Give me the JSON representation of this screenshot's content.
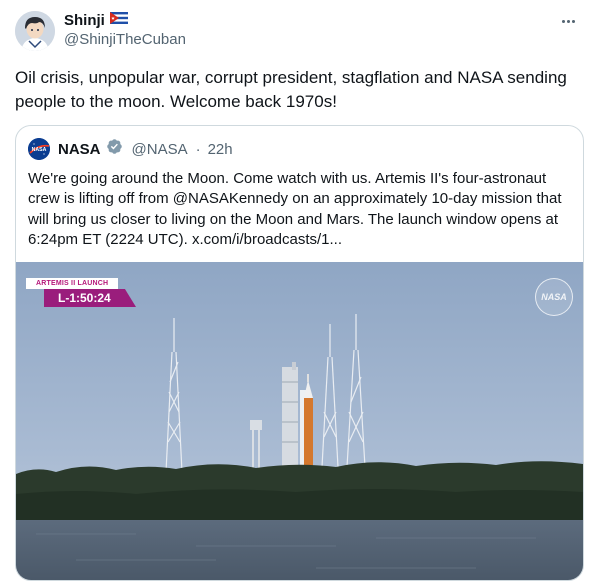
{
  "author": {
    "name": "Shinji",
    "flag_icon": "cuba-flag-icon",
    "handle": "@ShinjiTheCuban",
    "more_icon": "more-options-icon"
  },
  "tweet": {
    "text": "Oil crisis, unpopular war, corrupt president, stagflation and NASA sending people to the moon. Welcome back 1970s!"
  },
  "quote": {
    "name": "NASA",
    "logo_text": "NASA",
    "verified_icon": "verified-badge-icon",
    "handle": "@NASA",
    "separator": "·",
    "time": "22h",
    "text": "We're going around the Moon. Come watch with us. Artemis II's four-astronaut crew is lifting off from @NASAKennedy on an approximately 10-day mission that will bring us closer to living on the Moon and Mars. The launch window opens at 6:24pm ET (2224 UTC). x.com/i/broadcasts/1...",
    "media": {
      "badge_title": "ARTEMIS II LAUNCH",
      "countdown": "L-1:50:24",
      "watermark_text": "NASA"
    }
  },
  "colors": {
    "text": "#0f1419",
    "secondary": "#536471",
    "border": "#cfd9de",
    "verified": "#829aab",
    "badge": "#9a1d7c"
  }
}
